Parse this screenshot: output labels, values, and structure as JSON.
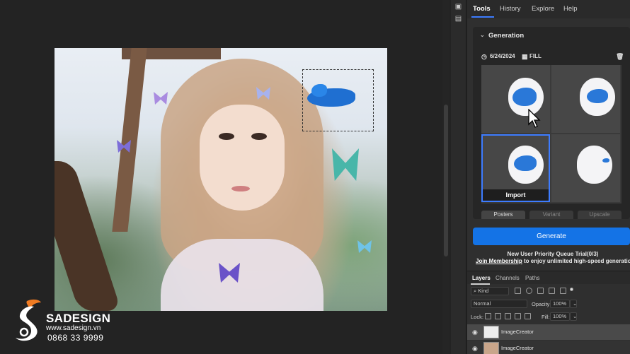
{
  "panel": {
    "tabs": [
      {
        "label": "Tools"
      },
      {
        "label": "History"
      },
      {
        "label": "Explore"
      },
      {
        "label": "Help"
      }
    ],
    "generation": {
      "title": "Generation",
      "date": "6/24/2024",
      "fill_label": "FILL",
      "import_label": "Import",
      "styles": [
        "Posters",
        "Variant",
        "Upscale"
      ]
    },
    "generate_label": "Generate",
    "trial_text": "New User Priority Queue Trial(0/3)",
    "membership_link": "Join Membership",
    "membership_rest": " to enjoy unlimited high-speed generation"
  },
  "layers": {
    "tabs": [
      "Layers",
      "Channels",
      "Paths"
    ],
    "kind_filter": "Kind",
    "blend_mode": "Normal",
    "opacity_label": "Opacity:",
    "opacity_value": "100%",
    "lock_label": "Lock:",
    "fill_label": "Fill:",
    "fill_value": "100%",
    "items": [
      {
        "name": "ImageCreator"
      },
      {
        "name": "ImageCreator"
      }
    ]
  },
  "watermark": {
    "brand": "SADESIGN",
    "url": "www.sadesign.vn",
    "phone": "0868 33 9999"
  },
  "colors": {
    "accent": "#1473e6",
    "selection": "#3d7cff",
    "logo_orange": "#f07b22"
  }
}
